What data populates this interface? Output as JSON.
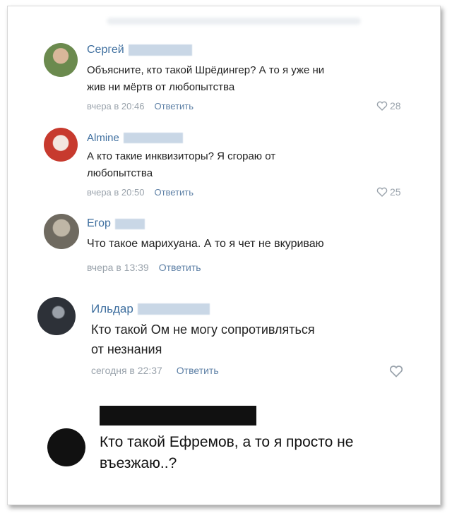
{
  "comments": [
    {
      "author": "Сергей",
      "lines": [
        "Объясните, кто такой Шрёдингер? А то я уже ни",
        "жив ни мёртв от любопытства"
      ],
      "time": "вчера в 20:46",
      "reply_label": "Ответить",
      "likes": "28"
    },
    {
      "author": "Almine",
      "lines": [
        "А кто такие инквизиторы? Я сгораю от",
        "любопытства"
      ],
      "time": "вчера в 20:50",
      "reply_label": "Ответить",
      "likes": "25"
    },
    {
      "author": "Егор",
      "lines": [
        "Что такое марихуана. А то я чет не вкуриваю"
      ],
      "time": "вчера в 13:39",
      "reply_label": "Ответить"
    },
    {
      "author": "Ильдар",
      "lines": [
        "Кто такой Ом не могу сопротивляться",
        "от незнания"
      ],
      "time": "сегодня в 22:37",
      "reply_label": "Ответить"
    },
    {
      "lines": [
        "Кто такой Ефремов, а то я просто не",
        "въезжаю..?"
      ]
    }
  ],
  "colors": {
    "author_name": "#3f6f9f",
    "reply_link": "#5c7fa5",
    "meta_text": "#9aa3ac",
    "redaction": "#c9d7e6",
    "censor_black": "#111111"
  },
  "icons": [
    "heart-icon"
  ]
}
